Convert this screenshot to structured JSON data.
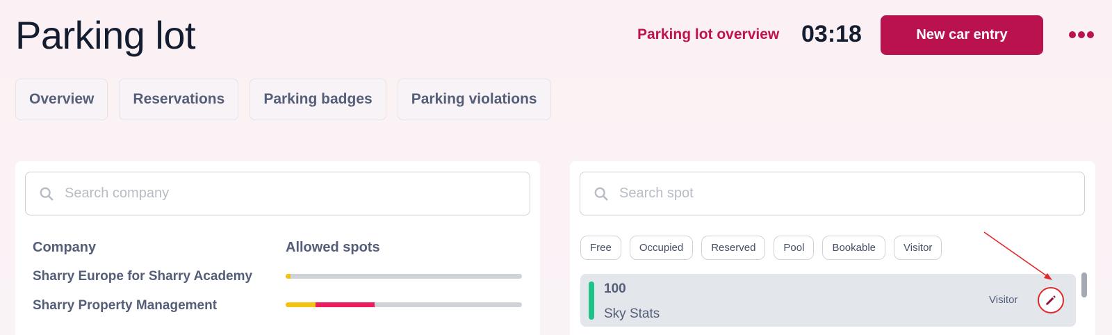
{
  "header": {
    "title": "Parking lot",
    "overview_link": "Parking lot overview",
    "clock": "03:18",
    "new_entry_label": "New car entry",
    "more_icon": "more-horizontal-icon"
  },
  "tabs": [
    {
      "label": "Overview"
    },
    {
      "label": "Reservations"
    },
    {
      "label": "Parking badges"
    },
    {
      "label": "Parking violations"
    }
  ],
  "companies": {
    "search_placeholder": "Search company",
    "col_company": "Company",
    "col_allowed": "Allowed spots",
    "rows": [
      {
        "name": "Sharry Europe for Sharry Academy",
        "usage": [
          {
            "color": "#f2c314",
            "fraction": 0.02
          }
        ]
      },
      {
        "name": "Sharry Property Management",
        "usage": [
          {
            "color": "#f2c314",
            "fraction": 0.125
          },
          {
            "color": "#ec1d5c",
            "fraction": 0.25
          }
        ]
      }
    ]
  },
  "spots": {
    "search_placeholder": "Search spot",
    "filters": [
      "Free",
      "Occupied",
      "Reserved",
      "Pool",
      "Bookable",
      "Visitor"
    ],
    "items": [
      {
        "number": "100",
        "name": "Sky Stats",
        "type": "Visitor",
        "status_color": "#1fc389"
      }
    ]
  },
  "colors": {
    "accent": "#b9124f",
    "annotation": "#e02a2a"
  }
}
